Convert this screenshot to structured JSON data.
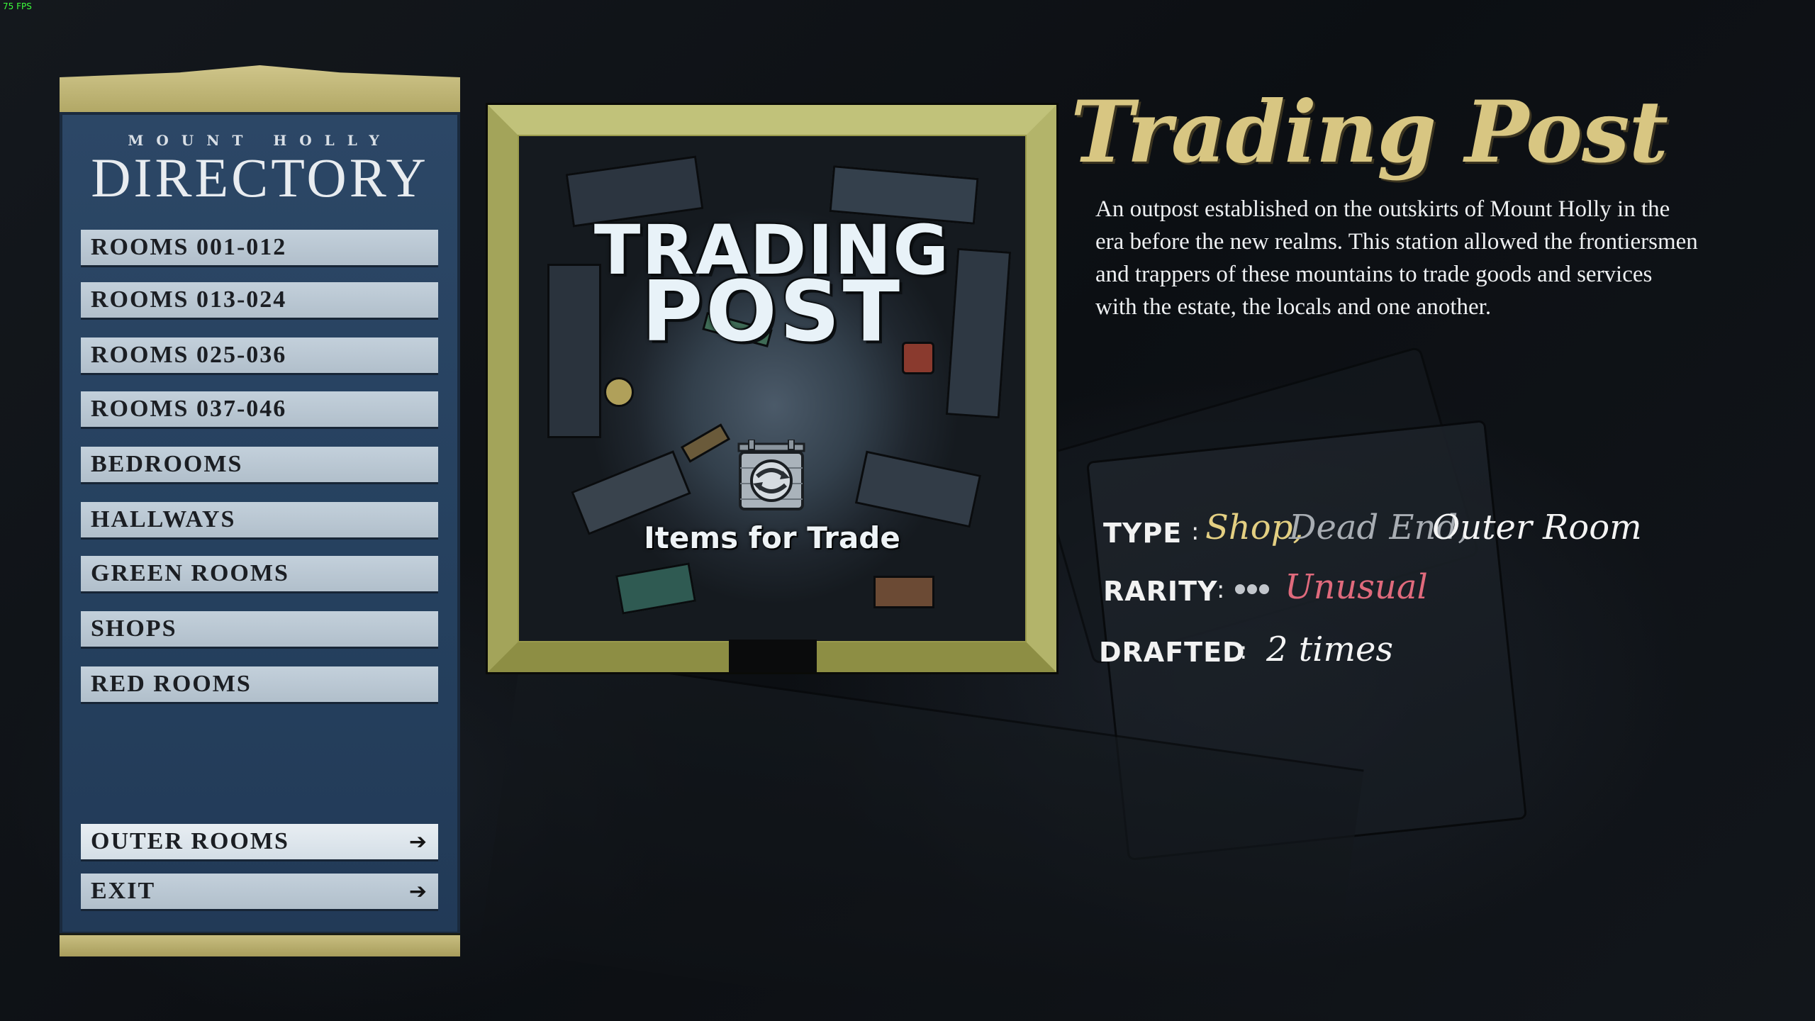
{
  "overlay": {
    "fps": "75 FPS"
  },
  "directory": {
    "subtitle": "MOUNT HOLLY",
    "title": "DIRECTORY",
    "items": [
      {
        "label": "ROOMS 001-012"
      },
      {
        "label": "ROOMS 013-024"
      },
      {
        "label": "ROOMS 025-036"
      },
      {
        "label": "ROOMS 037-046"
      },
      {
        "label": "BEDROOMS"
      },
      {
        "label": "HALLWAYS"
      },
      {
        "label": "GREEN ROOMS"
      },
      {
        "label": "SHOPS"
      },
      {
        "label": "RED ROOMS"
      }
    ],
    "bottom_items": [
      {
        "label": "OUTER ROOMS",
        "icon": "arrow-right-icon"
      },
      {
        "label": "EXIT",
        "icon": "arrow-right-icon"
      }
    ]
  },
  "room_card": {
    "title_line1": "TRADING",
    "title_line2": "POST",
    "icon": "trade-sign-icon",
    "caption": "Items for Trade"
  },
  "details": {
    "name": "Trading Post",
    "description": "An outpost established on the outskirts of Mount Holly in the era before the new realms. This station allowed the frontiersmen and trappers of these mountains to trade goods and services with the estate, the locals and one another.",
    "type_label": "TYPE",
    "type_values": [
      {
        "text": "Shop,",
        "color": "#e3cf82"
      },
      {
        "text": "Dead End,",
        "color": "#a8adb3"
      },
      {
        "text": "Outer Room",
        "color": "#f4f4f4"
      }
    ],
    "rarity_label": "RARITY",
    "rarity_dots": 3,
    "rarity_value": "Unusual",
    "rarity_color": "#e06a7c",
    "drafted_label": "DRAFTED",
    "drafted_value": "2 times",
    "separator": ":"
  },
  "colors": {
    "gold_title": "#d8c682",
    "panel_blue": "#2c4766",
    "button_face": "#c3d0db",
    "frame_olive": "#a3a45a"
  }
}
